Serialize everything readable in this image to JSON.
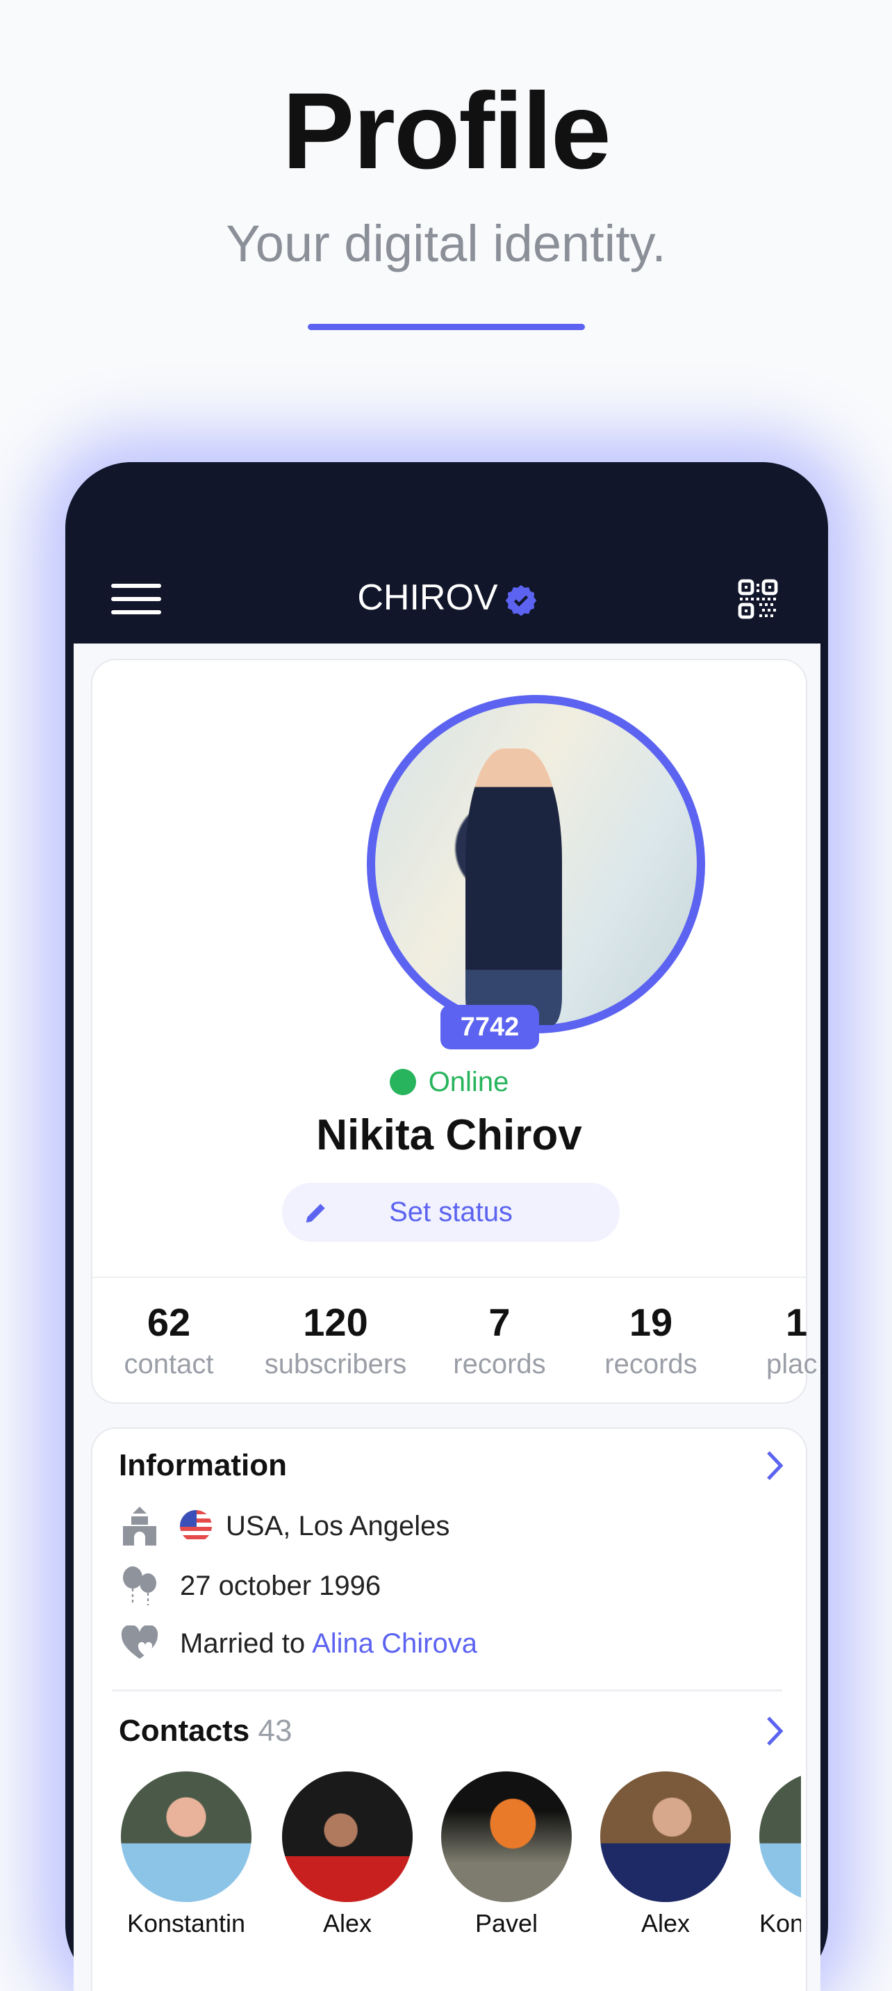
{
  "hero": {
    "title": "Profile",
    "subtitle": "Your digital identity.",
    "accent": "#5b63f0"
  },
  "appbar": {
    "title": "CHIROV",
    "verified_icon": "verified-badge-icon",
    "menu_icon": "hamburger-icon",
    "qr_icon": "qr-code-icon"
  },
  "profile": {
    "rating": "7742",
    "status": "Online",
    "name": "Nikita Chirov",
    "set_status_label": "Set status"
  },
  "stats": [
    {
      "value": "62",
      "label": "contact"
    },
    {
      "value": "120",
      "label": "subscribers"
    },
    {
      "value": "7",
      "label": "records"
    },
    {
      "value": "19",
      "label": "records"
    },
    {
      "value": "1",
      "label": "plac"
    }
  ],
  "information": {
    "title": "Information",
    "location": "USA, Los Angeles",
    "birthday": "27 october 1996",
    "married_prefix": "Married to",
    "spouse": "Alina Chirova"
  },
  "contacts": {
    "title": "Contacts",
    "count": "43",
    "items": [
      {
        "name": "Konstantin"
      },
      {
        "name": "Alex"
      },
      {
        "name": "Pavel"
      },
      {
        "name": "Alex"
      },
      {
        "name": "Kon"
      }
    ]
  }
}
